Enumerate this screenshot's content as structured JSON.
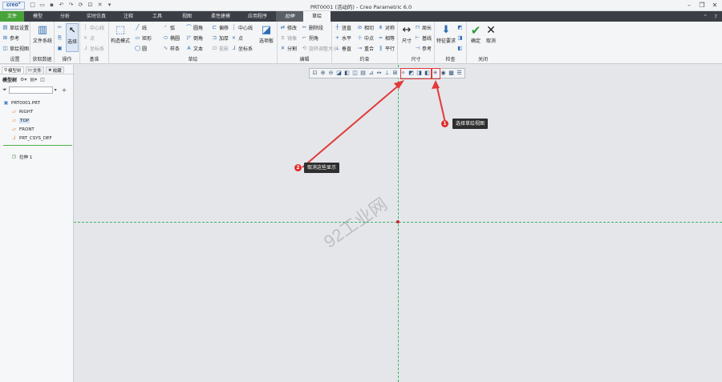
{
  "app": {
    "logo": "creo°",
    "window_title": "PRT0001 (活动的) - Creo Parametric 6.0"
  },
  "qat_icons": [
    "new-icon",
    "open-icon",
    "save-icon",
    "undo-icon",
    "redo-icon",
    "regenerate-icon",
    "windows-icon",
    "close-icon",
    "customize-icon"
  ],
  "tabs": [
    {
      "label": "文件",
      "kind": "file"
    },
    {
      "label": "模型"
    },
    {
      "label": "分析"
    },
    {
      "label": "实时仿真"
    },
    {
      "label": "注释"
    },
    {
      "label": "工具"
    },
    {
      "label": "视图"
    },
    {
      "label": "柔性建模"
    },
    {
      "label": "应用程序"
    },
    {
      "label": "拉伸",
      "kind": "context"
    },
    {
      "label": "草绘",
      "kind": "active"
    }
  ],
  "ribbon": {
    "settings": {
      "label": "设置",
      "items": [
        "草绘设置",
        "参考",
        "草绘视图"
      ]
    },
    "getdata": {
      "label": "获取数据",
      "items": [
        "文件系统"
      ]
    },
    "operations": {
      "label": "操作",
      "select": "选择"
    },
    "datum": {
      "label": "基准",
      "items": [
        "中心线",
        "点",
        "坐标系"
      ]
    },
    "sketch": {
      "label": "草绘",
      "construction": "构造模式",
      "items": [
        "线",
        "弧",
        "圆角",
        "偏移",
        "中心线",
        "矩形",
        "椭圆",
        "倒角",
        "加厚",
        "点",
        "圆",
        "样条",
        "文本",
        "投影",
        "坐标系"
      ],
      "palette": "选项板"
    },
    "edit": {
      "label": "编辑",
      "items": [
        "修改",
        "删除段",
        "镜像",
        "拐角",
        "分割",
        "旋转调整大小"
      ]
    },
    "constrain": {
      "label": "约束",
      "items": [
        "竖直",
        "相切",
        "对称",
        "水平",
        "中点",
        "相等",
        "垂直",
        "重合",
        "平行"
      ]
    },
    "dimension": {
      "label": "尺寸",
      "items": [
        "尺寸",
        "周长",
        "基线",
        "参考"
      ]
    },
    "inspect": {
      "label": "检查",
      "items": [
        "特征要求"
      ]
    },
    "close": {
      "label": "关闭",
      "items": [
        "确定",
        "取消"
      ]
    }
  },
  "left_panel": {
    "tabs": [
      "模型树",
      "文件",
      "收藏"
    ],
    "toolbar_label": "模型树",
    "filter_placeholder": "",
    "tree": [
      {
        "label": "PRT0001.PRT",
        "icon": "part-icon"
      },
      {
        "label": "RIGHT",
        "icon": "plane-icon"
      },
      {
        "label": "TOP",
        "icon": "plane-icon",
        "highlighted": true
      },
      {
        "label": "FRONT",
        "icon": "plane-icon"
      },
      {
        "label": "PRT_CSYS_DEF",
        "icon": "csys-icon"
      },
      {
        "label": "拉伸 1",
        "icon": "extrude-icon"
      }
    ]
  },
  "annotations": {
    "callout1": {
      "number": "1",
      "text": "选择草绘视图"
    },
    "callout2": {
      "number": "2",
      "text": "取消这些显示"
    },
    "watermark": "92工业网"
  },
  "colors": {
    "file_tab": "#47a23a",
    "ribbon_bg": "#f4f5f7",
    "canvas_bg": "#e4e6ea",
    "sketch_reference": "#3db46a",
    "annotation_red": "#e23a3a"
  }
}
